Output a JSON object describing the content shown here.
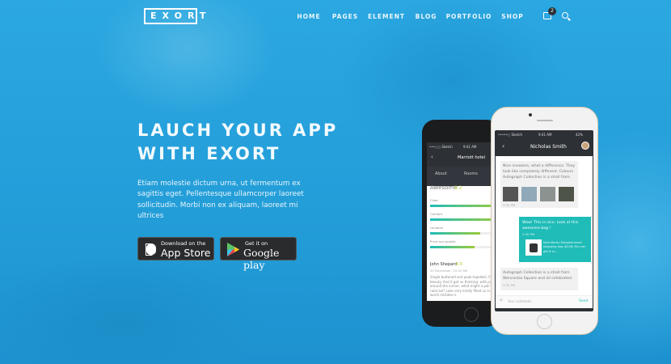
{
  "logo": "EXORT",
  "nav": [
    "HOME",
    "PAGES",
    "ELEMENT",
    "BLOG",
    "PORTFOLIO",
    "SHOP"
  ],
  "cart_count": "2",
  "hero": {
    "title_line1": "LAUCH YOUR APP",
    "title_line2": "WITH EXORT",
    "paragraph": "Etiam molestie dictum urna, ut fermentum ex sagittis eget. Pellentesque ullamcorper laoreet sollicitudin. Morbi non ex aliquam, laoreet mi ultrices"
  },
  "appstore": {
    "small": "Download on the",
    "big": "App Store"
  },
  "googleplay": {
    "small": "Get it on",
    "big": "Google play"
  },
  "phone_back": {
    "status_carrier": "•••○○ Sketch",
    "status_time": "9:41 AM",
    "title": "Marriott hotel",
    "tabs": [
      "About",
      "Rooms"
    ],
    "rating_label": "Awesome",
    "rating": "9.2",
    "bars": [
      {
        "label": "Clear",
        "value": 1.0
      },
      {
        "label": "Comfort",
        "value": 1.0
      },
      {
        "label": "Location",
        "value": 0.72
      },
      {
        "label": "Price and quality",
        "value": 0.64
      }
    ],
    "review_name": "John Shepard",
    "review_score": "8.8",
    "review_date": "20 November, 10:40 AM",
    "review_text": "Single buttoned and peak-lapelled, it's a thing of beauty. And it got us thinking: with party season just around the corner, what might a pair's eveningwear rules be? Luke very kindly filled us in. For me, the worst mistake is"
  },
  "phone_front": {
    "status_carrier": "•••••○ Sketch",
    "status_time": "9:41 AM",
    "battery": "42%",
    "title": "Nicholas Smith",
    "msg1": "Nice sneakers, what a difference. They look like completely different. Colours Autograph Collection is a stroll from.",
    "msg1_time": "2:30 PM",
    "msg2": "Wow! This is nice. Look at this awesome bag !",
    "msg2_time": "2:30 PM",
    "product": "Nice Martin Margiela black shopping bag ($230) You can get it in....",
    "msg3": "Autograph Collection is a stroll from Wenceslas Square and all celebrated.",
    "msg3_time": "2:30 PM",
    "input_placeholder": "Your comment...",
    "send": "Send"
  },
  "colors": {
    "accent": "#1fbcb8",
    "bg": "#28a4df"
  }
}
